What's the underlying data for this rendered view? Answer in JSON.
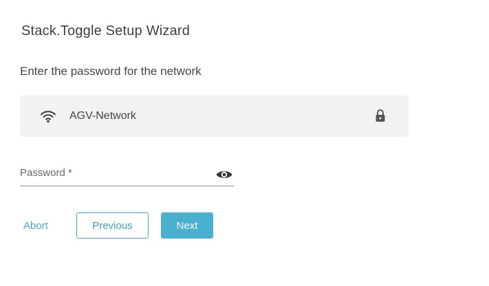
{
  "wizard": {
    "title": "Stack.Toggle Setup Wizard",
    "prompt": "Enter the password for the network"
  },
  "network": {
    "name": "AGV-Network",
    "signal_icon": "wifi-icon",
    "security_icon": "lock-icon"
  },
  "password": {
    "label": "Password *",
    "value": "",
    "visibility_icon": "eye-icon"
  },
  "actions": {
    "abort_label": "Abort",
    "previous_label": "Previous",
    "next_label": "Next"
  },
  "colors": {
    "accent": "#4ab0d0",
    "card_background": "#f2f2f2"
  }
}
